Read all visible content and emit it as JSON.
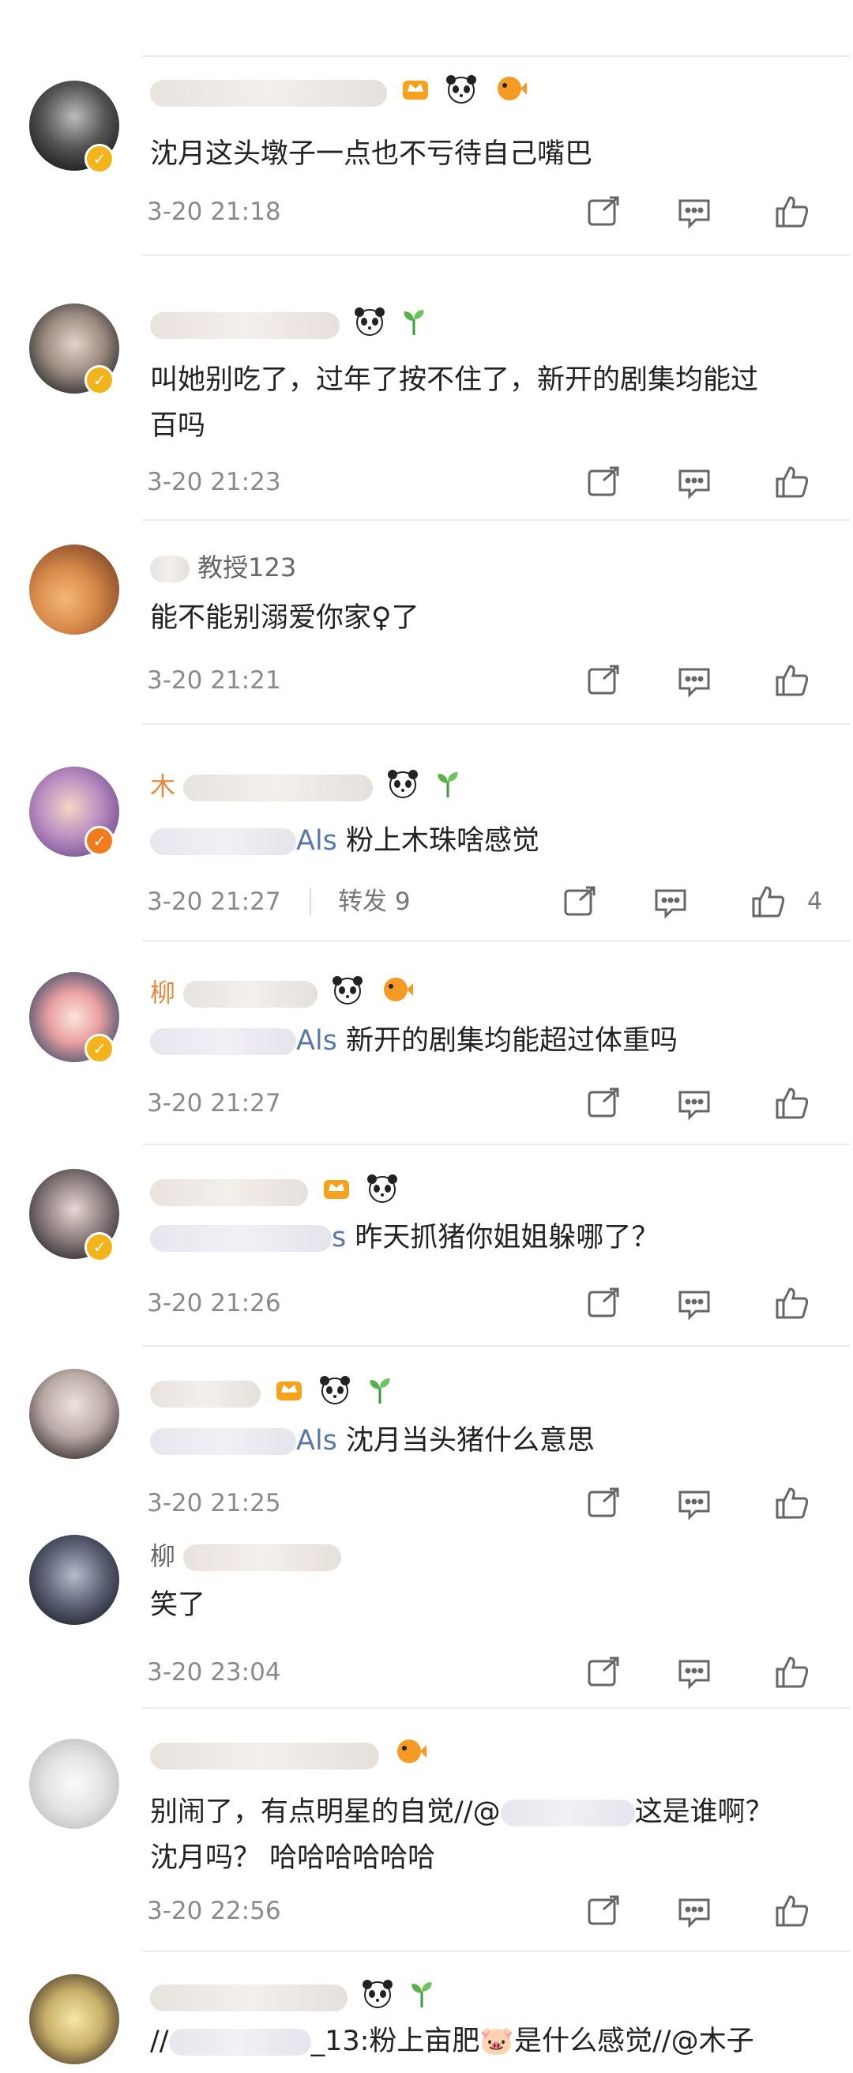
{
  "comments": [
    {
      "id": "c1",
      "avatar_name": "avatar-man-dark",
      "verified": "gold",
      "name_text": "",
      "emojis": [
        "crown-badge-icon",
        "panda-icon",
        "pufferfish-icon"
      ],
      "mention": "",
      "content": "沈月这头墩子一点也不亏待自己嘴巴",
      "content2": "",
      "time": "3-20 21:18",
      "repost": "",
      "likes": ""
    },
    {
      "id": "c2",
      "avatar_name": "avatar-man-sunglasses",
      "verified": "gold",
      "name_text": "",
      "emojis": [
        "panda-icon",
        "sprout-icon"
      ],
      "mention": "",
      "content": "叫她别吃了，过年了按不住了，新开的剧集均能过",
      "content2": "百吗",
      "time": "3-20 21:23",
      "repost": "",
      "likes": ""
    },
    {
      "id": "c3",
      "avatar_name": "avatar-cat",
      "verified": "",
      "name_text": "教授123",
      "emojis": [],
      "mention": "",
      "content": "能不能别溺爱你家♀了",
      "content2": "",
      "time": "3-20 21:21",
      "repost": "",
      "likes": ""
    },
    {
      "id": "c4",
      "avatar_name": "avatar-woman-purple",
      "verified": "orange",
      "name_text": "木",
      "emojis": [
        "panda-icon",
        "sprout-icon"
      ],
      "mention": "Als",
      "content": "粉上木珠啥感觉",
      "content2": "",
      "time": "3-20 21:27",
      "repost": "转发 9",
      "likes": "4"
    },
    {
      "id": "c5",
      "avatar_name": "avatar-couple-cartoon",
      "verified": "gold",
      "name_text": "柳",
      "emojis": [
        "panda-icon",
        "pufferfish-icon"
      ],
      "mention": "Als",
      "content": "新开的剧集均能超过体重吗",
      "content2": "",
      "time": "3-20 21:27",
      "repost": "",
      "likes": ""
    },
    {
      "id": "c6",
      "avatar_name": "avatar-woman-mirror",
      "verified": "gold",
      "name_text": "",
      "emojis": [
        "crown-badge-icon",
        "panda-icon"
      ],
      "mention": "s",
      "content": "昨天抓猪你姐姐躲哪了？",
      "content2": "",
      "time": "3-20 21:26",
      "repost": "",
      "likes": ""
    },
    {
      "id": "c7",
      "avatar_name": "avatar-woman-bob",
      "verified": "",
      "name_text": "",
      "emojis": [
        "crown-badge-icon",
        "panda-icon",
        "sprout-icon"
      ],
      "mention": "Als",
      "content": "沈月当头猪什么意思",
      "content2": "",
      "time": "3-20 21:25",
      "repost": "",
      "likes": ""
    },
    {
      "id": "c8",
      "avatar_name": "avatar-man-suit",
      "verified": "",
      "name_text": "柳",
      "emojis": [],
      "mention": "",
      "content": "笑了",
      "content2": "",
      "time": "3-20 23:04",
      "repost": "",
      "likes": ""
    },
    {
      "id": "c9",
      "avatar_name": "avatar-cat-paw",
      "verified": "",
      "name_text": "",
      "emojis": [
        "pufferfish-icon"
      ],
      "mention": "",
      "content": "别闹了，有点明星的自觉//@",
      "content_tail": "这是谁啊？",
      "content2": "沈月吗？ 哈哈哈哈哈哈",
      "time": "3-20 22:56",
      "repost": "",
      "likes": ""
    },
    {
      "id": "c10",
      "avatar_name": "avatar-anime-boy",
      "verified": "",
      "name_text": "",
      "emojis": [
        "panda-icon",
        "sprout-icon"
      ],
      "mention": "",
      "content": "//",
      "content_tail": "_13:粉上亩肥🐷是什么感觉//@木子",
      "content2": "",
      "time": "",
      "repost": "",
      "likes": ""
    }
  ],
  "colors": {
    "gold_badge": "#f2b31b",
    "orange_badge": "#f07c1e",
    "text": "#222222",
    "meta": "#8a8a8a",
    "mention": "#5b79a8"
  }
}
